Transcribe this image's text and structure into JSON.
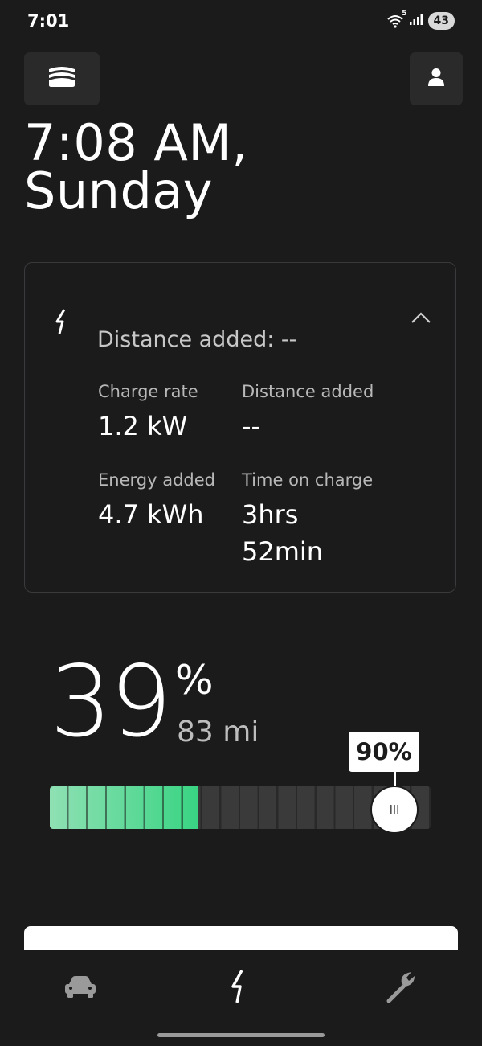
{
  "status_bar": {
    "time": "7:01",
    "wifi_badge": "5",
    "battery": "43"
  },
  "header": {
    "time_line": "7:08 AM,",
    "day_line": "Sunday"
  },
  "charging_card": {
    "summary": "Distance added: --",
    "charge_rate_label": "Charge rate",
    "charge_rate_value": "1.2 kW",
    "distance_added_label": "Distance added",
    "distance_added_value": "--",
    "energy_added_label": "Energy added",
    "energy_added_value": "4.7 kWh",
    "time_on_charge_label": "Time on charge",
    "time_on_charge_hours": "3hrs",
    "time_on_charge_minutes": "52min"
  },
  "battery": {
    "percent": "39",
    "percent_sign": "%",
    "range": "83 mi",
    "charge_level_fraction": 0.39,
    "charge_limit_label": "90%",
    "charge_limit_fraction": 0.9,
    "fill_color": "#39d483"
  },
  "icons": {
    "vehicle_button": "vehicle-stack-icon",
    "profile_button": "person-icon",
    "card": "lightning-bolt-icon",
    "collapse": "chevron-up-icon",
    "tabs": [
      "car-icon",
      "lightning-bolt-icon",
      "wrench-icon"
    ]
  },
  "colors": {
    "background": "#1b1b1c",
    "accent_green": "#39d483"
  }
}
